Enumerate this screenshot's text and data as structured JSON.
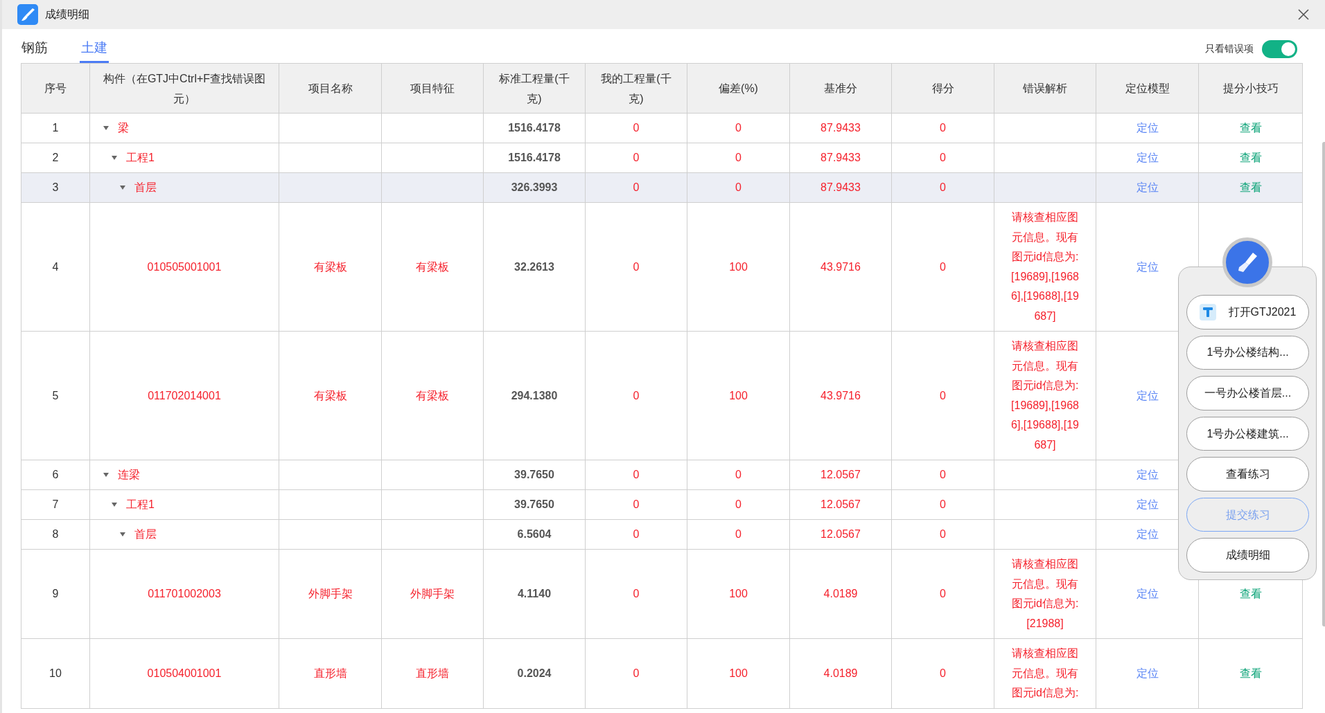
{
  "window": {
    "title": "成绩明细"
  },
  "tabs": [
    {
      "label": "钢筋",
      "selected": false
    },
    {
      "label": "土建",
      "selected": true
    }
  ],
  "error_filter": {
    "label": "只看错误项",
    "on": true
  },
  "table": {
    "columns": [
      "序号",
      "构件（在GTJ中Ctrl+F查找错误图元）",
      "项目名称",
      "项目特征",
      "标准工程量(千克)",
      "我的工程量(千克)",
      "偏差(%)",
      "基准分",
      "得分",
      "错误解析",
      "定位模型",
      "提分小技巧"
    ],
    "rows": [
      {
        "seq": "1",
        "component": "梁",
        "expanded": true,
        "selected": false,
        "std_qty": "1516.4178",
        "my_qty": "0",
        "deviation": "0",
        "base_score": "87.9433",
        "score": "0",
        "locate": "定位",
        "tip": "查看",
        "children": [
          {
            "seq": "2",
            "component": "工程1",
            "expanded": true,
            "selected": false,
            "std_qty": "1516.4178",
            "my_qty": "0",
            "deviation": "0",
            "base_score": "87.9433",
            "score": "0",
            "locate": "定位",
            "tip": "查看",
            "children": [
              {
                "seq": "3",
                "component": "首层",
                "expanded": true,
                "selected": true,
                "std_qty": "326.3993",
                "my_qty": "0",
                "deviation": "0",
                "base_score": "87.9433",
                "score": "0",
                "locate": "定位",
                "tip": "查看",
                "children": [
                  {
                    "seq": "4",
                    "component": "010505001001",
                    "selected": false,
                    "item_name": "有梁板",
                    "item_feature": "有梁板",
                    "std_qty": "32.2613",
                    "my_qty": "0",
                    "deviation": "100",
                    "base_score": "43.9716",
                    "score": "0",
                    "error": "请核查相应图元信息。现有图元id信息为:[19689],[19686],[19688],[19687]",
                    "locate": "定位"
                  },
                  {
                    "seq": "5",
                    "component": "011702014001",
                    "selected": false,
                    "item_name": "有梁板",
                    "item_feature": "有梁板",
                    "std_qty": "294.1380",
                    "my_qty": "0",
                    "deviation": "100",
                    "base_score": "43.9716",
                    "score": "0",
                    "error": "请核查相应图元信息。现有图元id信息为:[19689],[19686],[19688],[19687]",
                    "locate": "定位"
                  }
                ]
              }
            ]
          }
        ]
      },
      {
        "seq": "6",
        "component": "连梁",
        "expanded": true,
        "selected": false,
        "std_qty": "39.7650",
        "my_qty": "0",
        "deviation": "0",
        "base_score": "12.0567",
        "score": "0",
        "locate": "定位",
        "children": [
          {
            "seq": "7",
            "component": "工程1",
            "expanded": true,
            "selected": false,
            "std_qty": "39.7650",
            "my_qty": "0",
            "deviation": "0",
            "base_score": "12.0567",
            "score": "0",
            "locate": "定位",
            "children": [
              {
                "seq": "8",
                "component": "首层",
                "expanded": true,
                "selected": false,
                "std_qty": "6.5604",
                "my_qty": "0",
                "deviation": "0",
                "base_score": "12.0567",
                "score": "0",
                "locate": "定位",
                "children": [
                  {
                    "seq": "9",
                    "component": "011701002003",
                    "selected": false,
                    "item_name": "外脚手架",
                    "item_feature": "外脚手架",
                    "std_qty": "4.1140",
                    "my_qty": "0",
                    "deviation": "100",
                    "base_score": "4.0189",
                    "score": "0",
                    "error": "请核查相应图元信息。现有图元id信息为:[21988]",
                    "locate": "定位",
                    "tip": "查看"
                  },
                  {
                    "seq": "10",
                    "component": "010504001001",
                    "selected": false,
                    "item_name": "直形墙",
                    "item_feature": "直形墙",
                    "std_qty": "0.2024",
                    "my_qty": "0",
                    "deviation": "100",
                    "base_score": "4.0189",
                    "score": "0",
                    "error": "请核查相应图元信息。现有图元id信息为:",
                    "locate": "定位",
                    "tip": "查看"
                  }
                ]
              }
            ]
          }
        ]
      }
    ]
  },
  "float_menu": {
    "buttons": [
      {
        "label": "打开GTJ2021",
        "kind": "app",
        "selected": false
      },
      {
        "label": "1号办公楼结构...",
        "kind": "plain",
        "selected": false
      },
      {
        "label": "一号办公楼首层...",
        "kind": "plain",
        "selected": false
      },
      {
        "label": "1号办公楼建筑...",
        "kind": "plain",
        "selected": false
      },
      {
        "label": "查看练习",
        "kind": "plain",
        "selected": false
      },
      {
        "label": "提交练习",
        "kind": "plain",
        "selected": true
      },
      {
        "label": "成绩明细",
        "kind": "plain",
        "selected": false
      }
    ]
  }
}
